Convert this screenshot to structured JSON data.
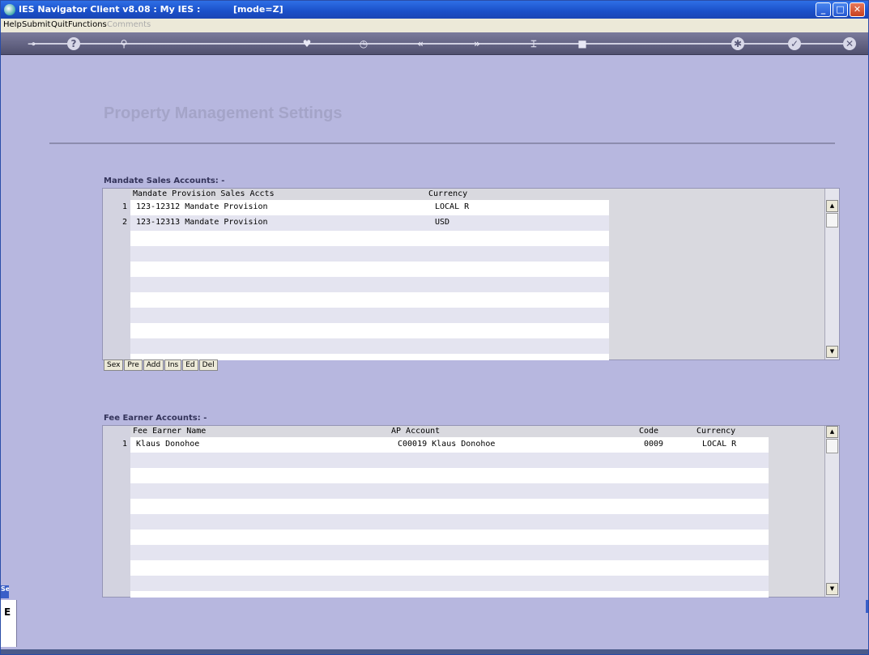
{
  "window": {
    "title": "IES Navigator Client v8.08 : My IES :",
    "mode": "[mode=Z]",
    "colors": {
      "background": "#b7b7df",
      "titlebar": "#1a4fc8"
    }
  },
  "menu": {
    "items": [
      "Help",
      "Submit",
      "Quit",
      "Functions"
    ],
    "disabled": "Comments"
  },
  "toolbar": {
    "icons": [
      "key-icon",
      "help-icon",
      "search-icon",
      "heart-icon",
      "clock-icon",
      "rewind-icon",
      "fast-forward-icon",
      "filter-icon",
      "stop-icon",
      "gear-icon",
      "check-icon",
      "close-icon"
    ]
  },
  "page": {
    "title": "Property Management Settings"
  },
  "mandate": {
    "label": "Mandate Sales Accounts: -",
    "headers": {
      "account": "Mandate Provision Sales Accts",
      "currency": "Currency"
    },
    "rows": [
      {
        "num": "1",
        "account": "123-12312 Mandate Provision",
        "currency": "LOCAL R"
      },
      {
        "num": "2",
        "account": "123-12313 Mandate Provision",
        "currency": "USD"
      }
    ],
    "buttons": [
      "Sex",
      "Pre",
      "Add",
      "Ins",
      "Ed",
      "Del"
    ]
  },
  "fee": {
    "label": "Fee Earner Accounts: -",
    "headers": {
      "name": "Fee Earner Name",
      "ap": "AP Account",
      "code": "Code",
      "currency": "Currency"
    },
    "rows": [
      {
        "num": "1",
        "name": "Klaus Donohoe",
        "ap": "C00019 Klaus Donohoe",
        "code": "0009",
        "currency": "LOCAL R"
      }
    ]
  },
  "side": {
    "tab_text": "Se",
    "letter": "E"
  }
}
